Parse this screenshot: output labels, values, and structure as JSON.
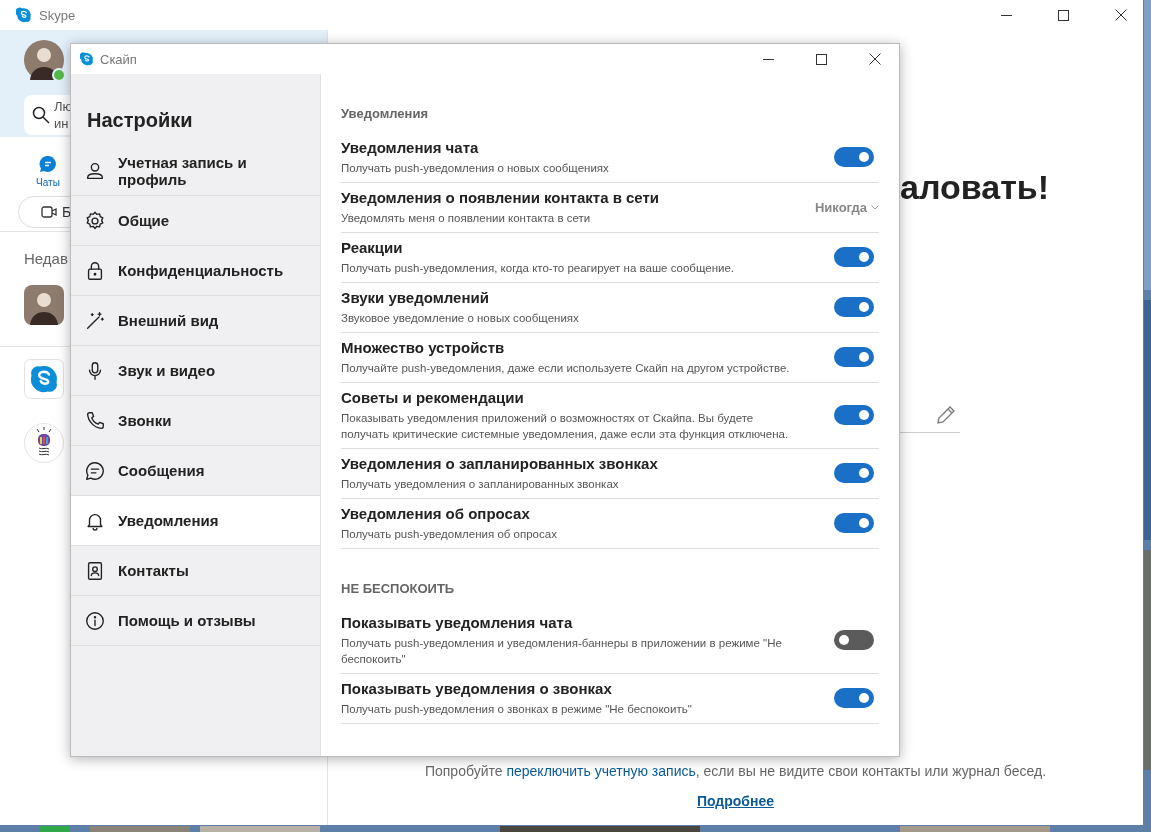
{
  "background_window": {
    "title": "Skype",
    "search_placeholder_lines": [
      "Лю",
      "ин"
    ],
    "chats_tab": "Чаты",
    "button_fragment": "Б",
    "recent_fragment": "Недав",
    "welcome_fragment": "аловать!",
    "hint": {
      "before": "Попробуйте ",
      "link": "переключить учетную запись",
      "after": ", если вы не видите свои контакты или журнал бесед."
    },
    "more_link": "Подробнее"
  },
  "dialog": {
    "title": "Скайп",
    "heading": "Настройки",
    "nav": [
      {
        "label": "Учетная запись и профиль",
        "kind": "person",
        "selected": false
      },
      {
        "label": "Общие",
        "kind": "gear",
        "selected": false
      },
      {
        "label": "Конфиденциальность",
        "kind": "lock",
        "selected": false
      },
      {
        "label": "Внешний вид",
        "kind": "wand",
        "selected": false
      },
      {
        "label": "Звук и видео",
        "kind": "mic",
        "selected": false
      },
      {
        "label": "Звонки",
        "kind": "phone",
        "selected": false
      },
      {
        "label": "Сообщения",
        "kind": "chat",
        "selected": false
      },
      {
        "label": "Уведомления",
        "kind": "bell",
        "selected": true
      },
      {
        "label": "Контакты",
        "kind": "contacts",
        "selected": false
      },
      {
        "label": "Помощь и отзывы",
        "kind": "info",
        "selected": false
      }
    ],
    "sections": [
      {
        "title": "Уведомления",
        "rows": [
          {
            "kind": "toggle",
            "title": "Уведомления чата",
            "description": "Получать push-уведомления о новых сообщениях",
            "on": true
          },
          {
            "kind": "dropdown",
            "title": "Уведомления о появлении контакта в сети",
            "description": "Уведомлять меня о появлении контакта в сети",
            "value": "Никогда"
          },
          {
            "kind": "toggle",
            "title": "Реакции",
            "description": "Получать push-уведомления, когда кто-то реагирует на ваше сообщение.",
            "on": true
          },
          {
            "kind": "toggle",
            "title": "Звуки уведомлений",
            "description": "Звуковое уведомление о новых сообщениях",
            "on": true
          },
          {
            "kind": "toggle",
            "title": "Множество устройств",
            "description": "Получайте push-уведомления, даже если используете Скайп на другом устройстве.",
            "on": true
          },
          {
            "kind": "toggle",
            "title": "Советы и рекомендации",
            "description": "Показывать уведомления приложений о возможностях от Скайпа. Вы будете получать критические системные уведомления, даже если эта функция отключена.",
            "on": true
          },
          {
            "kind": "toggle",
            "title": "Уведомления о запланированных звонках",
            "description": "Получать уведомления о запланированных звонках",
            "on": true
          },
          {
            "kind": "toggle",
            "title": "Уведомления об опросах",
            "description": "Получать push-уведомления об опросах",
            "on": true
          }
        ]
      },
      {
        "title": "НЕ БЕСПОКОИТЬ",
        "rows": [
          {
            "kind": "toggle",
            "title": "Показывать уведомления чата",
            "description": "Получать push-уведомления и уведомления-баннеры в приложении в режиме \"Не беспокоить\"",
            "on": false
          },
          {
            "kind": "toggle",
            "title": "Показывать уведомления о звонках",
            "description": "Получать push-уведомления о звонках в режиме \"Не беспокоить\"",
            "on": true
          }
        ]
      }
    ]
  }
}
